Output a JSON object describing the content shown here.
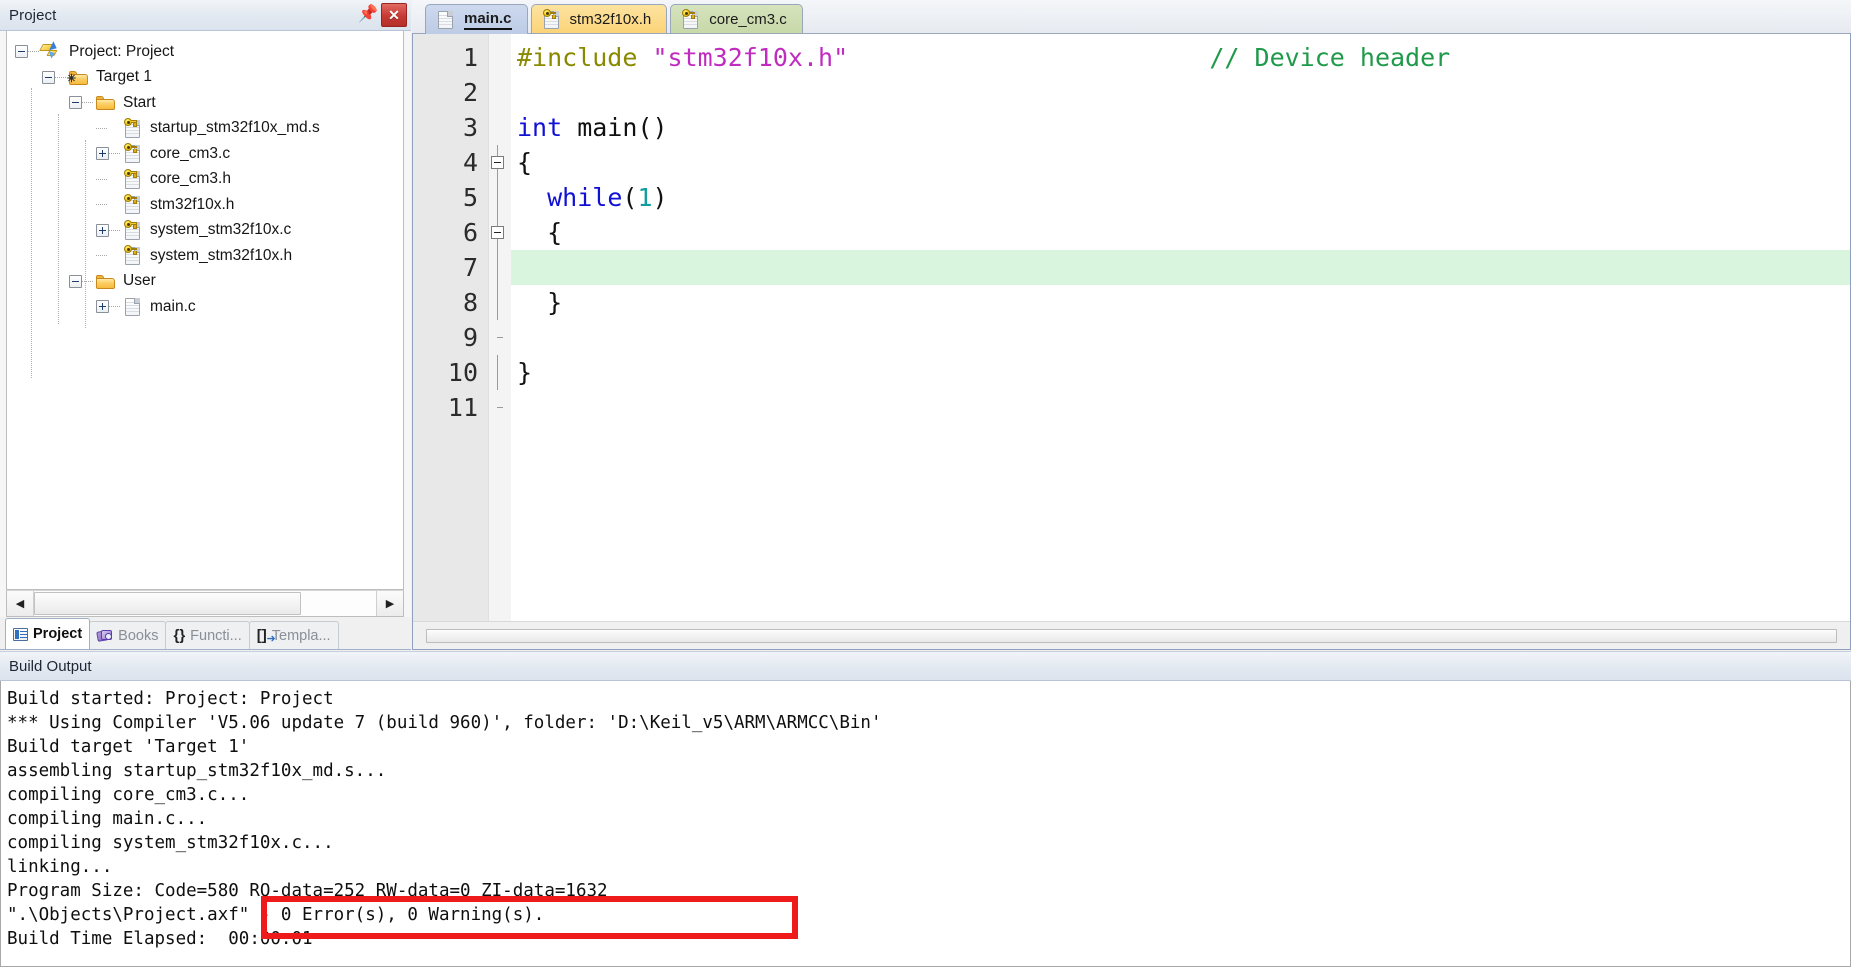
{
  "project_panel": {
    "title": "Project",
    "pin_icon": "pin-icon",
    "close_icon": "close-icon",
    "tree": [
      {
        "label": "Project: Project",
        "icon": "project-icon",
        "indent": 0,
        "expander": "minus"
      },
      {
        "label": "Target 1",
        "icon": "target-folder-icon",
        "indent": 1,
        "expander": "minus"
      },
      {
        "label": "Start",
        "icon": "folder-icon",
        "indent": 2,
        "expander": "minus"
      },
      {
        "label": "startup_stm32f10x_md.s",
        "icon": "source-file-icon",
        "indent": 3,
        "expander": "none"
      },
      {
        "label": "core_cm3.c",
        "icon": "source-file-icon",
        "indent": 3,
        "expander": "plus"
      },
      {
        "label": "core_cm3.h",
        "icon": "source-file-icon",
        "indent": 3,
        "expander": "none"
      },
      {
        "label": "stm32f10x.h",
        "icon": "source-file-icon",
        "indent": 3,
        "expander": "none"
      },
      {
        "label": "system_stm32f10x.c",
        "icon": "source-file-icon",
        "indent": 3,
        "expander": "plus"
      },
      {
        "label": "system_stm32f10x.h",
        "icon": "source-file-icon",
        "indent": 3,
        "expander": "none"
      },
      {
        "label": "User",
        "icon": "folder-icon",
        "indent": 2,
        "expander": "minus"
      },
      {
        "label": "main.c",
        "icon": "plain-file-icon",
        "indent": 3,
        "expander": "plus"
      }
    ],
    "hscroll": {
      "left_arrow": "◀",
      "right_arrow": "▶"
    },
    "tabs": [
      {
        "label": "Project",
        "icon": "project-small-icon",
        "active": true
      },
      {
        "label": "Books",
        "icon": "books-icon",
        "active": false
      },
      {
        "label": "Functi...",
        "icon": "functions-icon",
        "active": false
      },
      {
        "label": "Templa...",
        "icon": "templates-icon",
        "active": false
      }
    ]
  },
  "editor": {
    "tabs": [
      {
        "label": "main.c",
        "icon": "plain-file-icon",
        "active": true,
        "style": "main"
      },
      {
        "label": "stm32f10x.h",
        "icon": "source-file-icon",
        "active": false,
        "style": "hdr"
      },
      {
        "label": "core_cm3.c",
        "icon": "source-file-icon",
        "active": false,
        "style": "core"
      }
    ],
    "line_numbers": [
      "1",
      "2",
      "3",
      "4",
      "5",
      "6",
      "7",
      "8",
      "9",
      "10",
      "11"
    ],
    "lines": [
      {
        "n": 1,
        "segments": [
          {
            "t": "#include ",
            "c": "pre"
          },
          {
            "t": "\"stm32f10x.h\"",
            "c": "str"
          },
          {
            "t": "                        ",
            "c": "plain"
          },
          {
            "t": "// Device header",
            "c": "com"
          }
        ],
        "fold": "none",
        "highlight": false
      },
      {
        "n": 2,
        "segments": [],
        "fold": "none",
        "highlight": false
      },
      {
        "n": 3,
        "segments": [
          {
            "t": "int",
            "c": "kw"
          },
          {
            "t": " main()",
            "c": "plain"
          }
        ],
        "fold": "none",
        "highlight": false
      },
      {
        "n": 4,
        "segments": [
          {
            "t": "{",
            "c": "plain"
          }
        ],
        "fold": "box",
        "highlight": false
      },
      {
        "n": 5,
        "segments": [
          {
            "t": "  ",
            "c": "plain"
          },
          {
            "t": "while",
            "c": "kw"
          },
          {
            "t": "(",
            "c": "plain"
          },
          {
            "t": "1",
            "c": "num"
          },
          {
            "t": ")",
            "c": "plain"
          }
        ],
        "fold": "line",
        "highlight": false
      },
      {
        "n": 6,
        "segments": [
          {
            "t": "  {",
            "c": "plain"
          }
        ],
        "fold": "box",
        "highlight": false
      },
      {
        "n": 7,
        "segments": [],
        "fold": "line",
        "highlight": true
      },
      {
        "n": 8,
        "segments": [
          {
            "t": "  }",
            "c": "plain"
          }
        ],
        "fold": "line",
        "highlight": false
      },
      {
        "n": 9,
        "segments": [],
        "fold": "end",
        "highlight": false
      },
      {
        "n": 10,
        "segments": [
          {
            "t": "}",
            "c": "plain"
          }
        ],
        "fold": "line",
        "highlight": false
      },
      {
        "n": 11,
        "segments": [],
        "fold": "end",
        "highlight": false
      }
    ]
  },
  "build_output": {
    "title": "Build Output",
    "lines": [
      "Build started: Project: Project",
      "*** Using Compiler 'V5.06 update 7 (build 960)', folder: 'D:\\Keil_v5\\ARM\\ARMCC\\Bin'",
      "Build target 'Target 1'",
      "assembling startup_stm32f10x_md.s...",
      "compiling core_cm3.c...",
      "compiling main.c...",
      "compiling system_stm32f10x.c...",
      "linking...",
      "Program Size: Code=580 RO-data=252 RW-data=0 ZI-data=1632",
      "\".\\Objects\\Project.axf\" - 0 Error(s), 0 Warning(s).",
      "Build Time Elapsed:  00:00:01"
    ]
  },
  "annotation": {
    "highlight_color": "#ef1b1b",
    "target_text": "\" - 0 Error(s), 0 Warning(s)."
  }
}
